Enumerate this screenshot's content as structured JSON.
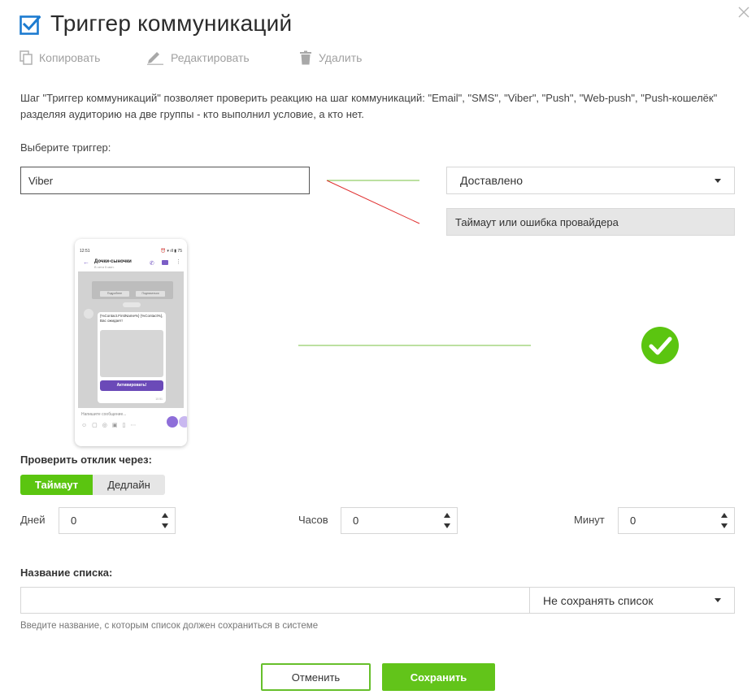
{
  "header": {
    "title": "Триггер коммуникаций",
    "accent_color": "#1c7bd0"
  },
  "toolbar": {
    "copy_label": "Копировать",
    "edit_label": "Редактировать",
    "delete_label": "Удалить"
  },
  "description": "Шаг \"Триггер коммуникаций\" позволяет проверить реакцию на шаг коммуникаций: \"Email\", \"SMS\", \"Viber\", \"Push\", \"Web-push\", \"Push-кошелёк\" разделяя аудиторию на две группы - кто выполнил условие, а кто нет.",
  "trigger": {
    "label": "Выберите триггер:",
    "value": "Viber",
    "condition_selected": "Доставлено",
    "fallback_label": "Таймаут или ошибка провайдера"
  },
  "phone_preview": {
    "time": "12:51",
    "status_icons": "⏰ ▾ ıll ▮ 75",
    "chat_name": "Дочки-сыночки",
    "chat_sub": "В сети 5 мин.",
    "notice_btn_1": "Подробнее",
    "notice_btn_2": "Подписаться",
    "message_text": "{%Contact.FirstName%} {%Contact%}, Вас ожидает!",
    "message_button": "Активировать!",
    "message_time": "10:51",
    "input_placeholder": "Напишите сообщение..."
  },
  "check_response": {
    "label": "Проверить отклик через:",
    "tabs": [
      {
        "label": "Таймаут",
        "active": true
      },
      {
        "label": "Дедлайн",
        "active": false
      }
    ],
    "fields": [
      {
        "label": "Дней",
        "value": "0"
      },
      {
        "label": "Часов",
        "value": "0"
      },
      {
        "label": "Минут",
        "value": "0"
      }
    ]
  },
  "list": {
    "label": "Название списка:",
    "value": "",
    "save_option": "Не сохранять список",
    "hint": "Введите название, с которым список должен сохраниться в системе"
  },
  "actions": {
    "cancel_label": "Отменить",
    "save_label": "Сохранить",
    "primary_color": "#62c41a"
  }
}
